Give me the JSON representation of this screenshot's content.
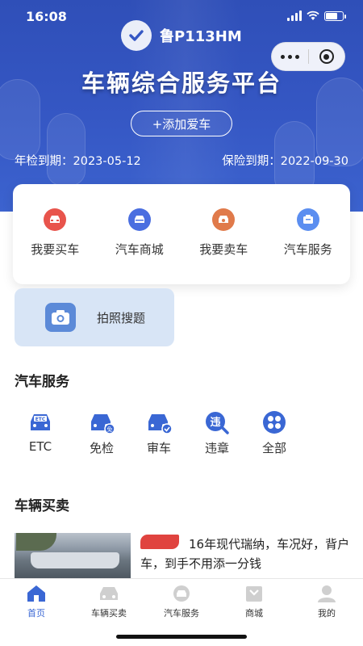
{
  "status_bar": {
    "time": "16:08"
  },
  "header": {
    "plate": "鲁P113HM",
    "title": "车辆综合服务平台",
    "add_car": "+添加爱车",
    "inspection_expiry": "年检到期：2023-05-12",
    "insurance_expiry": "保险到期：2022-09-30"
  },
  "menu": [
    {
      "label": "我要买车",
      "icon": "car-buy-icon",
      "color": "#e8544c"
    },
    {
      "label": "汽车商城",
      "icon": "car-mall-icon",
      "color": "#4a6ee0"
    },
    {
      "label": "我要卖车",
      "icon": "car-sell-icon",
      "color": "#e07a4a"
    },
    {
      "label": "汽车服务",
      "icon": "car-service-icon",
      "color": "#5b8ef0"
    }
  ],
  "photo_search": {
    "label": "拍照搜题",
    "icon": "camera-icon"
  },
  "car_services": {
    "title": "汽车服务",
    "items": [
      {
        "label": "ETC",
        "icon": "etc-icon"
      },
      {
        "label": "免检",
        "icon": "exempt-icon"
      },
      {
        "label": "审车",
        "icon": "inspect-icon"
      },
      {
        "label": "违章",
        "icon": "violation-icon"
      },
      {
        "label": "全部",
        "icon": "all-icon"
      }
    ]
  },
  "trading": {
    "title": "车辆买卖",
    "listing_text": "16年现代瑞纳，车况好，背户车，到手不用添一分钱"
  },
  "tabbar": [
    {
      "label": "首页",
      "icon": "home-icon",
      "active": true
    },
    {
      "label": "车辆买卖",
      "icon": "car-trade-icon",
      "active": false
    },
    {
      "label": "汽车服务",
      "icon": "car-service-tab-icon",
      "active": false
    },
    {
      "label": "商城",
      "icon": "mall-icon",
      "active": false
    },
    {
      "label": "我的",
      "icon": "user-icon",
      "active": false
    }
  ],
  "colors": {
    "primary": "#3a67d4",
    "banner": "#3557c4",
    "accent_red": "#e0433f"
  }
}
